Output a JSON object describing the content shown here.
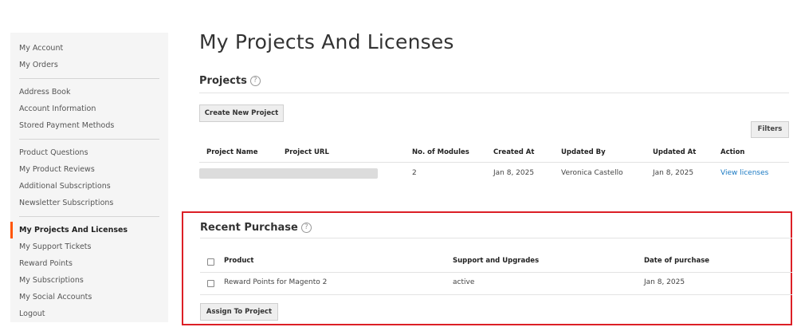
{
  "sidebar": {
    "groups": [
      [
        "My Account",
        "My Orders"
      ],
      [
        "Address Book",
        "Account Information",
        "Stored Payment Methods"
      ],
      [
        "Product Questions",
        "My Product Reviews",
        "Additional Subscriptions",
        "Newsletter Subscriptions"
      ],
      [
        "My Projects And Licenses",
        "My Support Tickets",
        "Reward Points",
        "My Subscriptions",
        "My Social Accounts",
        "Logout"
      ]
    ],
    "active": "My Projects And Licenses"
  },
  "page": {
    "title": "My Projects And Licenses"
  },
  "projects": {
    "title": "Projects",
    "help_glyph": "?",
    "create_button": "Create New Project",
    "filters_button": "Filters",
    "columns": [
      "Project Name",
      "Project URL",
      "No. of Modules",
      "Created At",
      "Updated By",
      "Updated At",
      "Action"
    ],
    "rows": [
      {
        "modules": "2",
        "created": "Jan 8, 2025",
        "updated_by": "Veronica Castello",
        "updated_at": "Jan 8, 2025",
        "action": "View licenses"
      }
    ]
  },
  "recent_purchase": {
    "title": "Recent Purchase",
    "help_glyph": "?",
    "columns": [
      "Product",
      "Support and Upgrades",
      "Date of purchase"
    ],
    "rows": [
      {
        "product": "Reward Points for Magento 2",
        "support": "active",
        "date": "Jan 8, 2025"
      }
    ],
    "assign_button": "Assign To Project"
  },
  "colors": {
    "accent": "#ff5501",
    "link": "#1979c3",
    "highlight_border": "#dc1f26"
  }
}
